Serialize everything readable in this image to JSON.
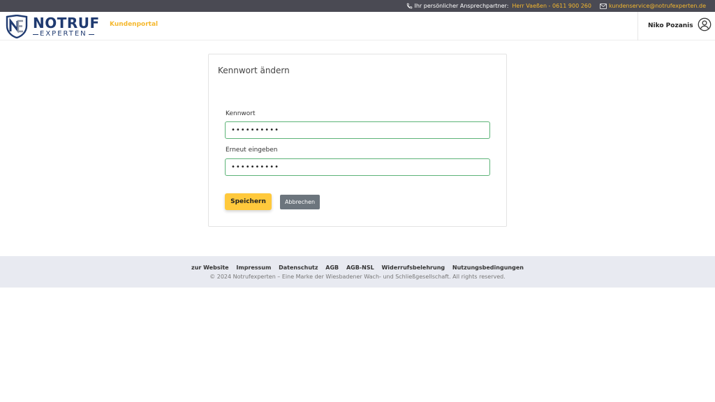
{
  "topbar": {
    "contact_label": "Ihr persönlicher Ansprechpartner:",
    "contact_person": "Herr Vaeßen - 0611 900 260",
    "email": "kundenservice@notrufexperten.de",
    "icons": {
      "phone": "phone-icon",
      "mail": "mail-icon"
    }
  },
  "header": {
    "logo": {
      "top": "NOTRUF",
      "bottom": "EXPERTEN"
    },
    "nav_portal": "Kundenportal",
    "user_name": "Niko Pozanis",
    "user_icon": "user-circle-icon"
  },
  "form": {
    "title": "Kennwort ändern",
    "password_label": "Kennwort",
    "password_value": "••••••••••",
    "repeat_label": "Erneut eingeben",
    "repeat_value": "••••••••••",
    "save_label": "Speichern",
    "cancel_label": "Abbrechen"
  },
  "footer": {
    "links": [
      "zur Website",
      "Impressum",
      "Datenschutz",
      "AGB",
      "AGB-NSL",
      "Widerrufsbelehrung",
      "Nutzungsbedingungen"
    ],
    "copyright": "© 2024 Notrufexperten – Eine Marke der Wiesbadener Wach- und Schließgesellschaft. All rights reserved."
  },
  "colors": {
    "accent": "#f5b82e",
    "brand": "#1f3a70",
    "topbar": "#4a4a53",
    "input_border": "#5cb377",
    "save_button": "#ffc93c",
    "cancel_button": "#6c757d",
    "footer_bg": "#e8eaf1"
  }
}
